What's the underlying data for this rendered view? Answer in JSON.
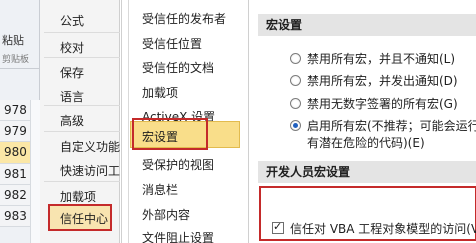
{
  "excel": {
    "paste_label": "粘贴",
    "clipboard_label": "剪贴板",
    "row_numbers": [
      "978",
      "979",
      "980",
      "981",
      "982",
      "983"
    ],
    "selected_row": "980"
  },
  "options_menu": {
    "items": [
      "公式",
      "校对",
      "保存",
      "语言",
      "高级",
      "自定义功能",
      "快速访问工",
      "加载项",
      "信任中心"
    ]
  },
  "trust_nav": {
    "items": [
      "受信任的发布者",
      "受信任位置",
      "受信任的文档",
      "加载项",
      "ActiveX 设置",
      "宏设置",
      "受保护的视图",
      "消息栏",
      "外部内容",
      "文件阻止设置"
    ],
    "selected": "宏设置"
  },
  "macro_settings": {
    "header": "宏设置",
    "options": [
      {
        "label": "禁用所有宏，并且不通知(L)",
        "checked": false
      },
      {
        "label": "禁用所有宏，并发出通知(D)",
        "checked": false
      },
      {
        "label": "禁用无数字签署的所有宏(G)",
        "checked": false
      },
      {
        "label": "启用所有宏(不推荐；可能会运行",
        "label2": "有潜在危险的代码)(E)",
        "checked": true
      }
    ]
  },
  "developer_settings": {
    "header": "开发人员宏设置",
    "vba_trust_label": "信任对 VBA 工程对象模型的访问(V)",
    "vba_trust_checked": true
  },
  "colors": {
    "highlight_outline": "#c42a2a",
    "selected_fill": "#f9de8a",
    "radio_dot": "#1f5fbf"
  }
}
